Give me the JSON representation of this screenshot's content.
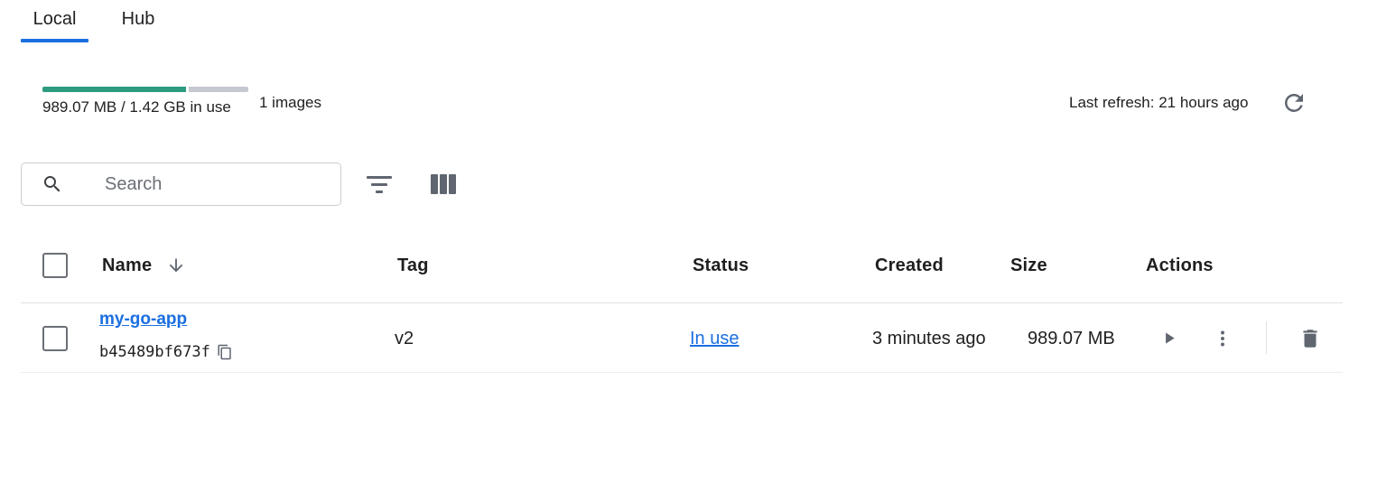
{
  "tabs": [
    {
      "label": "Local",
      "active": true
    },
    {
      "label": "Hub",
      "active": false
    }
  ],
  "usage": {
    "text": "989.07 MB / 1.42 GB in use",
    "fraction_used": 0.68,
    "images_count": "1 images"
  },
  "refresh": {
    "text": "Last refresh: 21 hours ago",
    "icon": "refresh-icon"
  },
  "search": {
    "placeholder": "Search",
    "value": ""
  },
  "toolbar": {
    "filter_icon": "filter-icon",
    "columns_icon": "columns-icon"
  },
  "table": {
    "columns": [
      "Name",
      "Tag",
      "Status",
      "Created",
      "Size",
      "Actions"
    ],
    "sort": {
      "column": "Name",
      "direction": "descending"
    },
    "rows": [
      {
        "name": "my-go-app",
        "id": "b45489bf673f",
        "tag": "v2",
        "status": "In use",
        "created": "3 minutes ago",
        "size": "989.07 MB",
        "actions": [
          "run-icon",
          "more-vert-icon",
          "delete-icon"
        ]
      }
    ]
  },
  "colors": {
    "accent": "#1a6fe0",
    "usage_used": "#2e9b80",
    "usage_free": "#c5c8cf",
    "icon": "#5f6670"
  }
}
